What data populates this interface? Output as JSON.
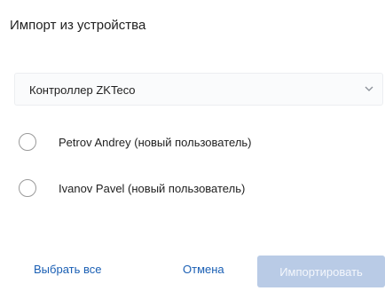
{
  "dialog": {
    "title": "Импорт из устройства"
  },
  "device_select": {
    "selected_value": "Контроллер ZKTeco",
    "icon": "chevron-down-icon"
  },
  "users": [
    {
      "label": "Petrov Andrey (новый пользователь)",
      "checked": false
    },
    {
      "label": "Ivanov Pavel (новый пользователь)",
      "checked": false
    }
  ],
  "footer": {
    "select_all_label": "Выбрать все",
    "cancel_label": "Отмена",
    "import_label": "Импортировать"
  },
  "colors": {
    "link": "#1a5fb4",
    "primary_disabled_bg": "#b9cbe6",
    "radio_border": "#9a9a9a"
  }
}
